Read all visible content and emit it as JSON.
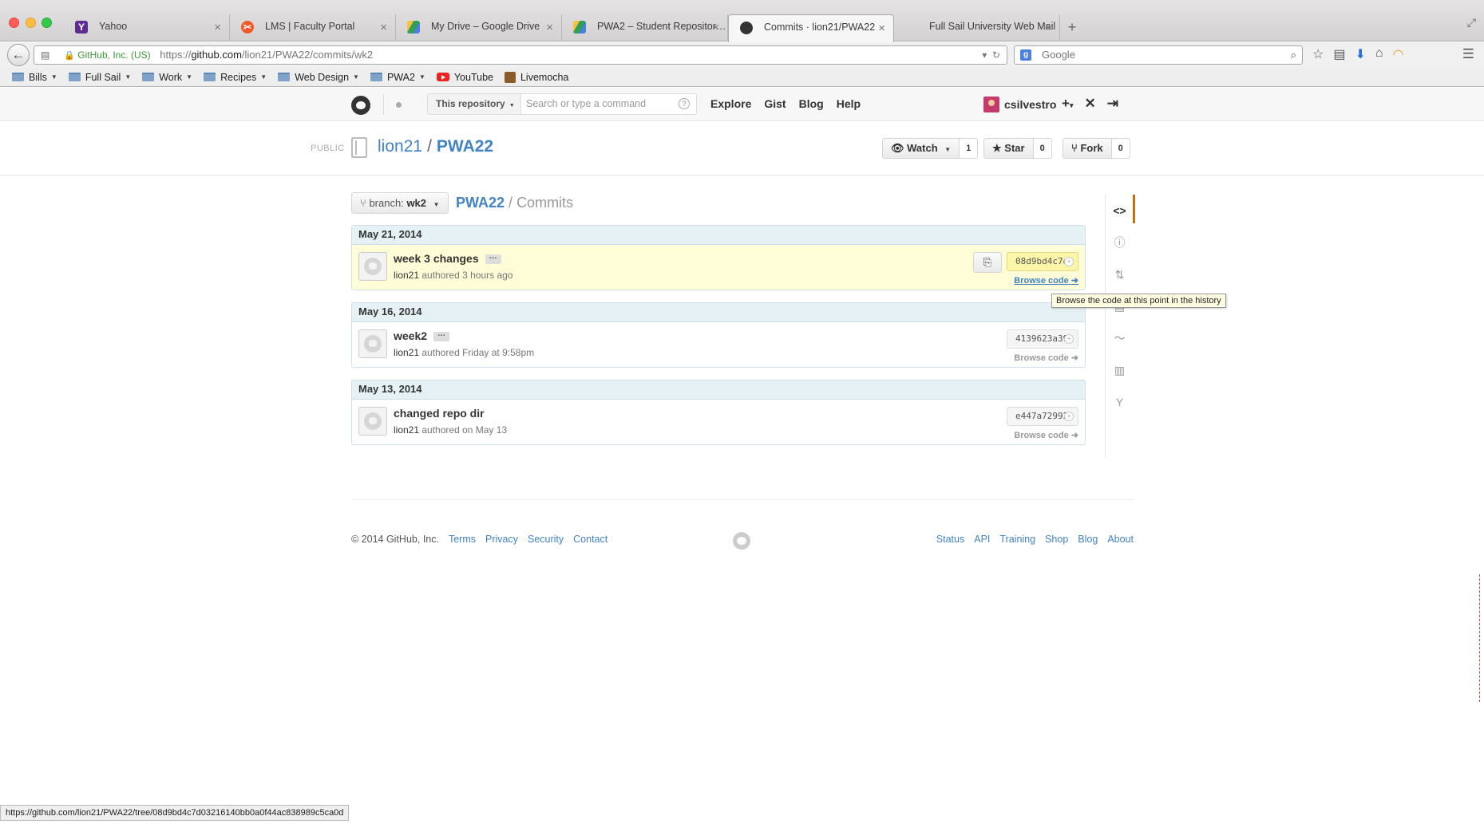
{
  "browser": {
    "tabs": [
      {
        "label": "Yahoo",
        "favicon": "yahoo-icon",
        "color": "#5c2c91",
        "active": false
      },
      {
        "label": "LMS | Faculty Portal",
        "favicon": "lms-icon",
        "color": "#f05a28",
        "active": false
      },
      {
        "label": "My Drive – Google Drive",
        "favicon": "google-drive-icon",
        "color": "#2f9e5a",
        "active": false
      },
      {
        "label": "PWA2 – Student Repositor…",
        "favicon": "google-drive-icon",
        "color": "#2f9e5a",
        "active": false
      },
      {
        "label": "Commits · lion21/PWA22",
        "favicon": "github-icon",
        "color": "#333333",
        "active": true
      },
      {
        "label": "Full Sail University Web Mail",
        "favicon": "mail-icon",
        "color": "#ffffff",
        "active": false
      }
    ],
    "new_tab": "+",
    "identity": "GitHub, Inc. (US)",
    "url_prefix": "https://",
    "url_host": "github.com",
    "url_path": "/lion21/PWA22/commits/wk2",
    "search_placeholder": "Google",
    "bookmarks": [
      {
        "label": "Bills",
        "type": "folder"
      },
      {
        "label": "Full Sail",
        "type": "folder"
      },
      {
        "label": "Work",
        "type": "folder"
      },
      {
        "label": "Recipes",
        "type": "folder"
      },
      {
        "label": "Web Design",
        "type": "folder"
      },
      {
        "label": "PWA2",
        "type": "folder"
      },
      {
        "label": "YouTube",
        "type": "youtube"
      },
      {
        "label": "Livemocha",
        "type": "livemocha"
      }
    ],
    "status_url": "https://github.com/lion21/PWA22/tree/08d9bd4c7d03216140bb0a0f44ac838989c5ca0d"
  },
  "github": {
    "scope": "This repository",
    "search_placeholder": "Search or type a command",
    "nav": [
      "Explore",
      "Gist",
      "Blog",
      "Help"
    ],
    "username": "csilvestro"
  },
  "repo": {
    "visibility": "PUBLIC",
    "owner": "lion21",
    "name": "PWA22",
    "watch_label": "Watch",
    "watch_count": "1",
    "star_label": "Star",
    "star_count": "0",
    "fork_label": "Fork",
    "fork_count": "0"
  },
  "commits_page": {
    "branch_prefix": "branch:",
    "branch": "wk2",
    "crumb_repo": "PWA22",
    "crumb_page": "Commits",
    "browse_label": "Browse code",
    "groups": [
      {
        "date": "May 21, 2014",
        "commits": [
          {
            "message": "week 3 changes",
            "author": "lion21",
            "when": "authored 3 hours ago",
            "sha": "08d9bd4c7d",
            "highlighted": true
          }
        ]
      },
      {
        "date": "May 16, 2014",
        "commits": [
          {
            "message": "week2",
            "author": "lion21",
            "when": "authored Friday at 9:58pm",
            "sha": "4139623a39",
            "highlighted": false
          }
        ]
      },
      {
        "date": "May 13, 2014",
        "commits": [
          {
            "message": "changed repo dir",
            "author": "lion21",
            "when": "authored on May 13",
            "sha": "e447a72992",
            "highlighted": false
          }
        ]
      }
    ],
    "tooltip": "Browse the code at this point in the history"
  },
  "footer": {
    "copyright": "© 2014 GitHub, Inc.",
    "left_links": [
      "Terms",
      "Privacy",
      "Security",
      "Contact"
    ],
    "right_links": [
      "Status",
      "API",
      "Training",
      "Shop",
      "Blog",
      "About"
    ]
  },
  "colors": {
    "link": "#4183c4",
    "highlight": "#fefdd8",
    "date_header": "#e6f1f6",
    "active_nav": "#d26911"
  }
}
